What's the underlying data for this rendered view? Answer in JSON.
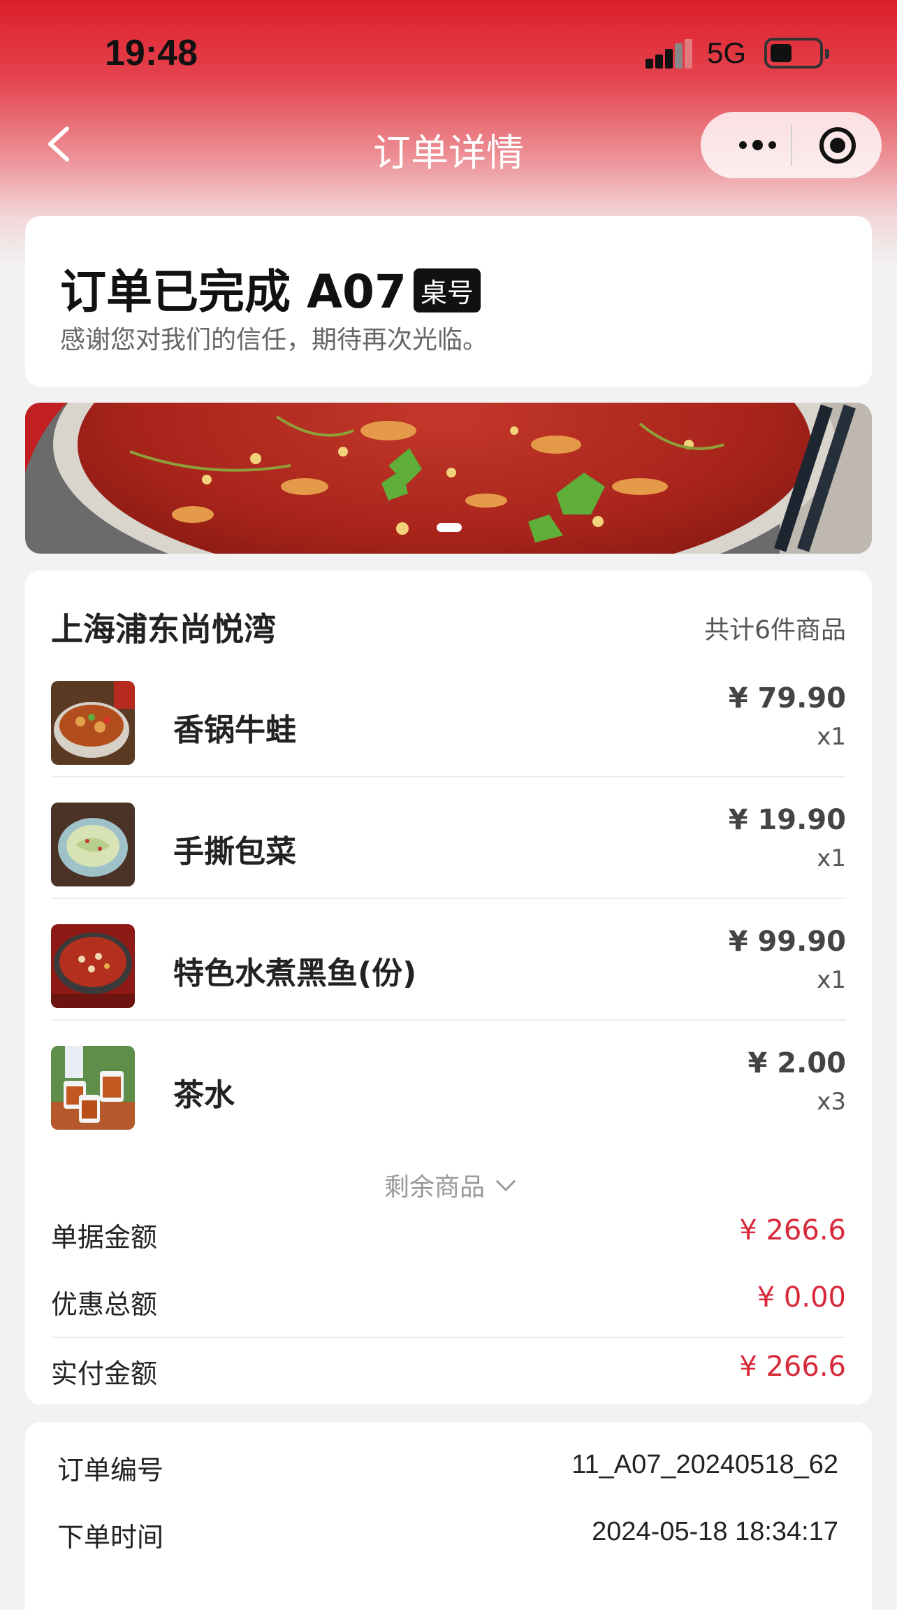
{
  "status_bar": {
    "time": "19:48",
    "network": "5G"
  },
  "nav": {
    "title": "订单详情"
  },
  "order_status": {
    "title": "订单已完成 A07",
    "table_tag": "桌号",
    "subtitle": "感谢您对我们的信任，期待再次光临。"
  },
  "store": {
    "name": "上海浦东尚悦湾",
    "item_count": "共计6件商品"
  },
  "items": [
    {
      "name": "香锅牛蛙",
      "price": "¥ 79.90",
      "qty": "x1"
    },
    {
      "name": "手撕包菜",
      "price": "¥ 19.90",
      "qty": "x1"
    },
    {
      "name": "特色水煮黑鱼(份)",
      "price": "¥ 99.90",
      "qty": "x1"
    },
    {
      "name": "茶水",
      "price": "¥ 2.00",
      "qty": "x3"
    }
  ],
  "more_items_label": "剩余商品",
  "summary": [
    {
      "label": "单据金额",
      "value": "¥ 266.6"
    },
    {
      "label": "优惠总额",
      "value": "¥ 0.00"
    },
    {
      "label": "实付金额",
      "value": "¥ 266.6"
    }
  ],
  "info": [
    {
      "label": "订单编号",
      "value": "11_A07_20240518_62"
    },
    {
      "label": "下单时间",
      "value": "2024-05-18 18:34:17"
    }
  ],
  "colors": {
    "brand_red": "#dd1f2c",
    "price_red": "#d8293a"
  },
  "icons": [
    "back-arrow-icon",
    "more-dots-icon",
    "close-target-icon",
    "chevron-down-icon",
    "signal-icon",
    "battery-icon"
  ]
}
